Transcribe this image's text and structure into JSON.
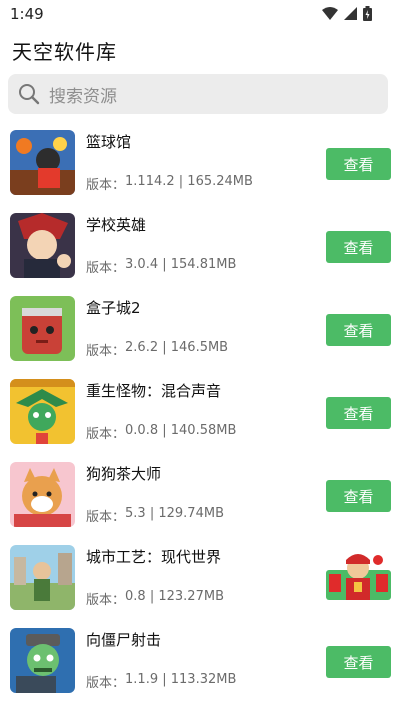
{
  "status_bar": {
    "time": "1:49",
    "icons": [
      "wifi-icon",
      "signal-icon",
      "battery-icon"
    ]
  },
  "app_title": "天空软件库",
  "search": {
    "placeholder": "搜索资源",
    "icon": "search-icon"
  },
  "accent_color": "#4cbb66",
  "apps": [
    {
      "name": "篮球馆",
      "version_label": "版本：",
      "version": "1.114.2",
      "size": "165.24MB",
      "action": "查看"
    },
    {
      "name": "学校英雄",
      "version_label": "版本：",
      "version": "3.0.4",
      "size": "154.81MB",
      "action": "查看"
    },
    {
      "name": "盒子城2",
      "version_label": "版本：",
      "version": "2.6.2",
      "size": "146.5MB",
      "action": "查看"
    },
    {
      "name": "重生怪物：混合声音",
      "version_label": "版本：",
      "version": "0.0.8",
      "size": "140.58MB",
      "action": "查看"
    },
    {
      "name": "狗狗茶大师",
      "version_label": "版本：",
      "version": "5.3",
      "size": "129.74MB",
      "action": "查看"
    },
    {
      "name": "城市工艺：现代世界",
      "version_label": "版本：",
      "version": "0.8",
      "size": "123.27MB",
      "action": ""
    },
    {
      "name": "向僵尸射击",
      "version_label": "版本：",
      "version": "1.1.9",
      "size": "113.32MB",
      "action": "查看"
    }
  ],
  "separator": " | "
}
